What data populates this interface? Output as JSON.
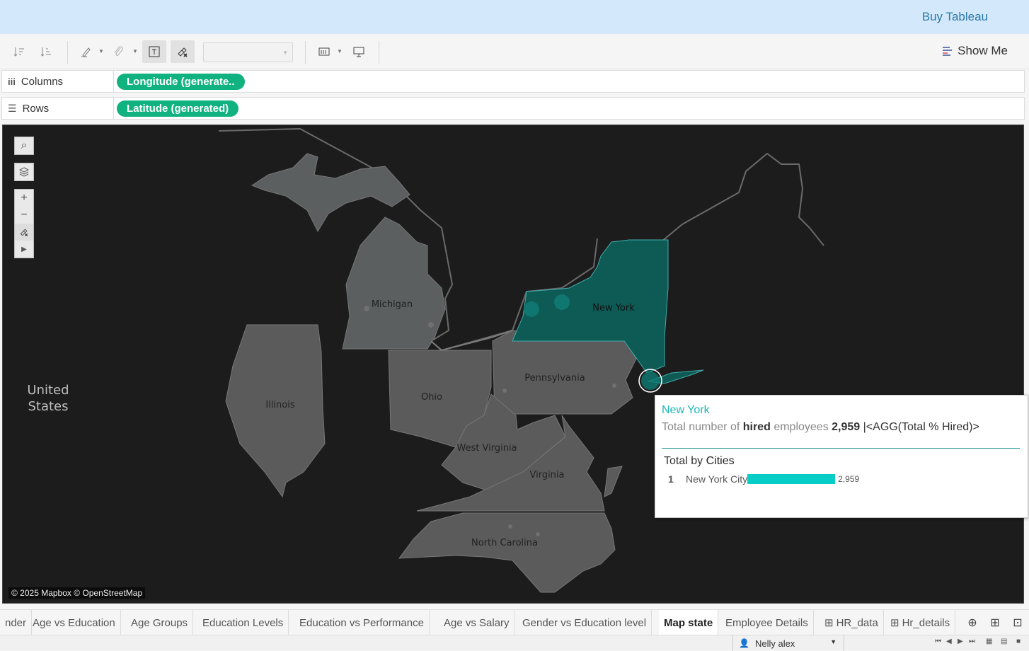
{
  "header": {
    "buy_label": "Buy Tableau"
  },
  "toolbar": {
    "show_me_label": "Show Me",
    "mark_type_value": ""
  },
  "shelves": {
    "columns": {
      "label": "Columns",
      "pill": "Longitude (generate.."
    },
    "rows": {
      "label": "Rows",
      "pill": "Latitude (generated)"
    }
  },
  "map": {
    "country_label_line1": "United",
    "country_label_line2": "States",
    "states": {
      "michigan": "Michigan",
      "new_york": "New York",
      "pennsylvania": "Pennsylvania",
      "ohio": "Ohio",
      "illinois": "Illinois",
      "west_virginia": "West Virginia",
      "virginia": "Virginia",
      "north_carolina": "North Carolina"
    },
    "attribution": "© 2025 Mapbox © OpenStreetMap",
    "highlight_color": "#0e5a55"
  },
  "tooltip": {
    "title": "New York",
    "line_prefix": "Total number of",
    "line_bold": "hired",
    "line_mid": "employees",
    "line_value": "2,959",
    "line_suffix": "|<AGG(Total % Hired)>",
    "subtitle_prefix": "Total by",
    "subtitle_bold": "Cities",
    "rows": [
      {
        "rank": "1",
        "city": "New York City",
        "value": "2,959",
        "fill": 1.0
      }
    ],
    "bar_color": "#08cdc6"
  },
  "tabs": [
    "nder",
    "Age vs Education",
    "Age Groups",
    "Education Levels",
    "Education vs Performance",
    "Age vs Salary",
    "Gender vs Education level",
    "Map state",
    "Employee Details",
    "HR_data",
    "Hr_details"
  ],
  "active_tab": "Map state",
  "status": {
    "user": "Nelly alex"
  }
}
